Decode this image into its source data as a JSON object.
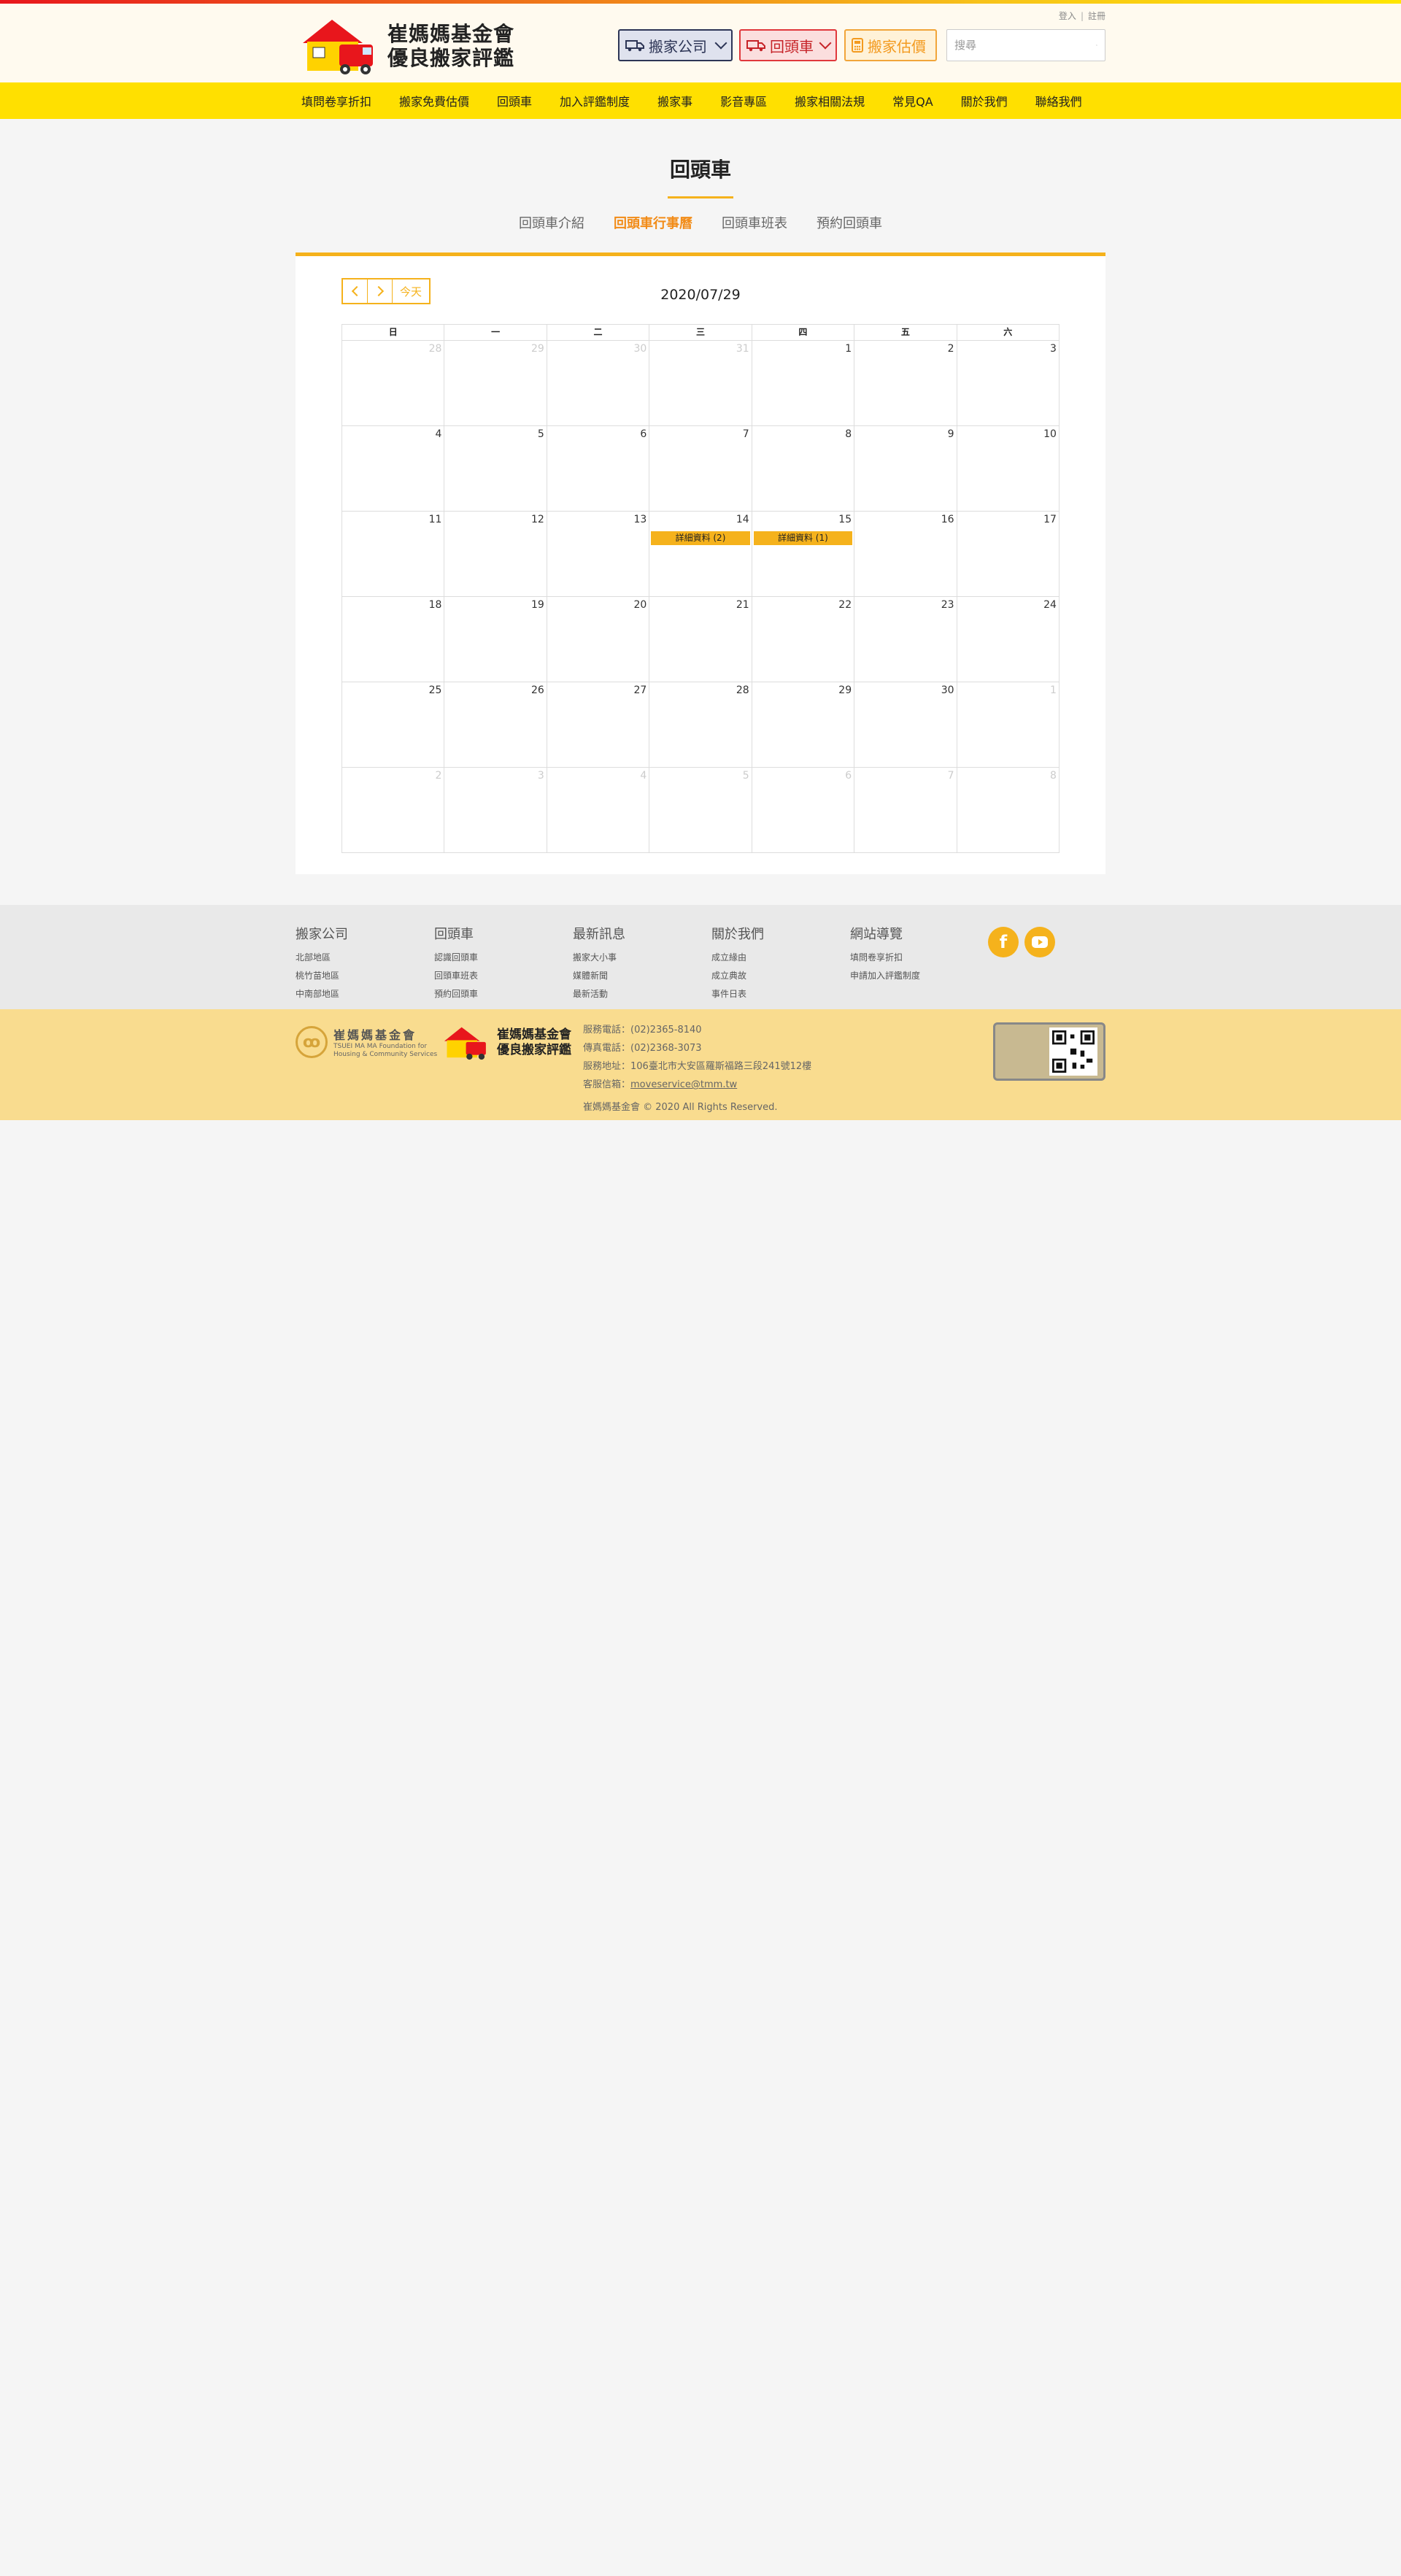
{
  "header": {
    "logo_line1": "崔媽媽基金會",
    "logo_line2": "優良搬家評鑑",
    "login": "登入",
    "register": "註冊",
    "btn_company": "搬家公司",
    "btn_return": "回頭車",
    "btn_estimate": "搬家估價",
    "search_placeholder": "搜尋"
  },
  "nav": [
    "填問卷享折扣",
    "搬家免費估價",
    "回頭車",
    "加入評鑑制度",
    "搬家事",
    "影音專區",
    "搬家相關法規",
    "常見QA",
    "關於我們",
    "聯絡我們"
  ],
  "page": {
    "title": "回頭車",
    "tabs": [
      "回頭車介紹",
      "回頭車行事曆",
      "回頭車班表",
      "預約回頭車"
    ],
    "active_tab": 1
  },
  "calendar": {
    "title": "2020/07/29",
    "today_label": "今天",
    "weekdays": [
      "日",
      "一",
      "二",
      "三",
      "四",
      "五",
      "六"
    ],
    "weeks": [
      [
        {
          "d": "28",
          "o": true
        },
        {
          "d": "29",
          "o": true
        },
        {
          "d": "30",
          "o": true
        },
        {
          "d": "31",
          "o": true
        },
        {
          "d": "1"
        },
        {
          "d": "2"
        },
        {
          "d": "3"
        }
      ],
      [
        {
          "d": "4"
        },
        {
          "d": "5"
        },
        {
          "d": "6"
        },
        {
          "d": "7"
        },
        {
          "d": "8"
        },
        {
          "d": "9"
        },
        {
          "d": "10"
        }
      ],
      [
        {
          "d": "11"
        },
        {
          "d": "12"
        },
        {
          "d": "13"
        },
        {
          "d": "14",
          "e": "詳細資料 (2)"
        },
        {
          "d": "15",
          "e": "詳細資料 (1)"
        },
        {
          "d": "16"
        },
        {
          "d": "17"
        }
      ],
      [
        {
          "d": "18"
        },
        {
          "d": "19"
        },
        {
          "d": "20"
        },
        {
          "d": "21"
        },
        {
          "d": "22"
        },
        {
          "d": "23"
        },
        {
          "d": "24"
        }
      ],
      [
        {
          "d": "25"
        },
        {
          "d": "26"
        },
        {
          "d": "27"
        },
        {
          "d": "28"
        },
        {
          "d": "29"
        },
        {
          "d": "30"
        },
        {
          "d": "1",
          "o": true
        }
      ],
      [
        {
          "d": "2",
          "o": true
        },
        {
          "d": "3",
          "o": true
        },
        {
          "d": "4",
          "o": true
        },
        {
          "d": "5",
          "o": true
        },
        {
          "d": "6",
          "o": true
        },
        {
          "d": "7",
          "o": true
        },
        {
          "d": "8",
          "o": true
        }
      ]
    ]
  },
  "footer": {
    "columns": [
      {
        "title": "搬家公司",
        "items": [
          "北部地區",
          "桃竹苗地區",
          "中南部地區"
        ]
      },
      {
        "title": "回頭車",
        "items": [
          "認識回頭車",
          "回頭車班表",
          "預約回頭車"
        ]
      },
      {
        "title": "最新訊息",
        "items": [
          "搬家大小事",
          "媒體新聞",
          "最新活動"
        ]
      },
      {
        "title": "關於我們",
        "items": [
          "成立緣由",
          "成立典故",
          "事件日表"
        ]
      },
      {
        "title": "網站導覽",
        "items": [
          "填問卷享折扣",
          "申請加入評鑑制度"
        ]
      }
    ],
    "org_name": "崔媽媽基金會",
    "org_en1": "TSUEI MA MA Foundation for",
    "org_en2": "Housing & Community Services",
    "logo2_line1": "崔媽媽基金會",
    "logo2_line2": "優良搬家評鑑",
    "phone": "服務電話：(02)2365-8140",
    "fax": "傳真電話：(02)2368-3073",
    "address": "服務地址：106臺北市大安區羅斯福路三段241號12樓",
    "email_label": "客服信箱：",
    "email": "moveservice@tmm.tw",
    "copyright": "崔媽媽基金會 © 2020 All Rights Reserved."
  },
  "colors": {
    "accent": "#f5b21c",
    "nav": "#ffe000",
    "active_tab": "#f28c18"
  }
}
